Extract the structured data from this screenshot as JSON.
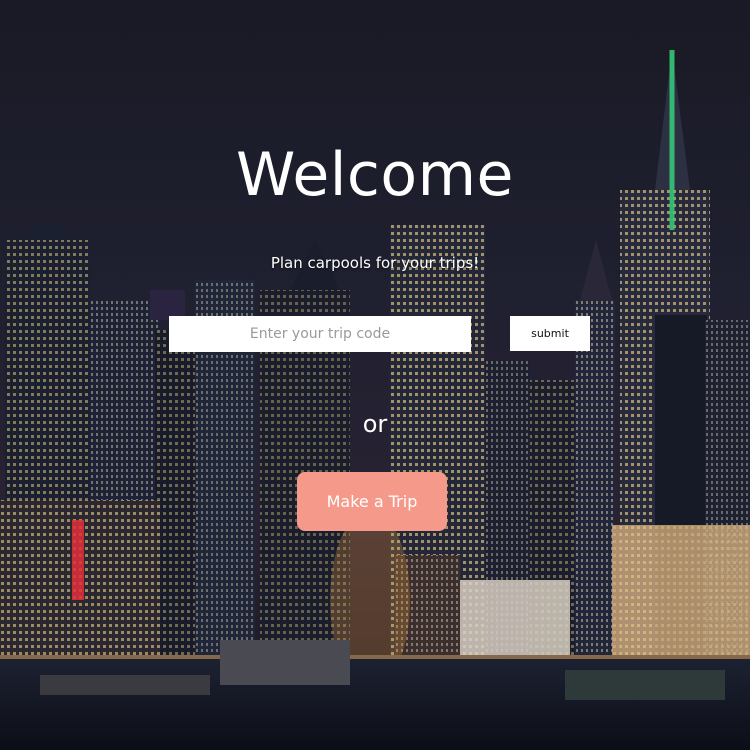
{
  "hero": {
    "title": "Welcome",
    "tagline": "Plan carpools for your trips!",
    "background": "night-city-skyline-image"
  },
  "trip_code": {
    "placeholder": "Enter your trip code",
    "value": "",
    "submit_label": "submit"
  },
  "divider_text": "or",
  "make_trip": {
    "label": "Make a Trip",
    "color": "#f59a8a"
  }
}
